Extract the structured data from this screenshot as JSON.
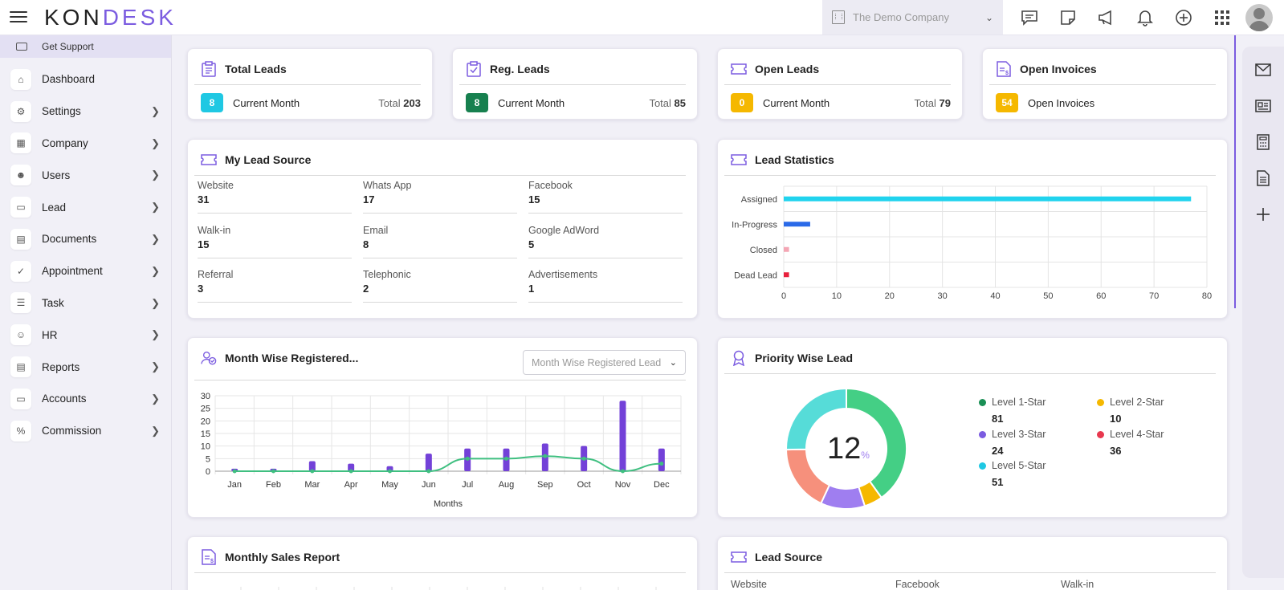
{
  "app": {
    "logo_left": "KON",
    "logo_right": "DESK",
    "company": "The Demo Company"
  },
  "top_icons": [
    "chat-icon",
    "sticky-note-icon",
    "megaphone-icon",
    "bell-icon",
    "plus-circle-icon",
    "apps-grid-icon"
  ],
  "sidebar": {
    "support": "Get Support",
    "items": [
      {
        "label": "Dashboard",
        "icon": "home-icon",
        "arrow": false
      },
      {
        "label": "Settings",
        "icon": "gear-icon",
        "arrow": true
      },
      {
        "label": "Company",
        "icon": "building-icon",
        "arrow": true
      },
      {
        "label": "Users",
        "icon": "users-icon",
        "arrow": true
      },
      {
        "label": "Lead",
        "icon": "ticket-icon",
        "arrow": true
      },
      {
        "label": "Documents",
        "icon": "document-icon",
        "arrow": true
      },
      {
        "label": "Appointment",
        "icon": "calendar-check-icon",
        "arrow": true
      },
      {
        "label": "Task",
        "icon": "task-list-icon",
        "arrow": true
      },
      {
        "label": "HR",
        "icon": "hr-icon",
        "arrow": true
      },
      {
        "label": "Reports",
        "icon": "report-icon",
        "arrow": true
      },
      {
        "label": "Accounts",
        "icon": "accounts-icon",
        "arrow": true
      },
      {
        "label": "Commission",
        "icon": "percent-icon",
        "arrow": true
      }
    ]
  },
  "rail_icons": [
    "mail-icon",
    "id-card-icon",
    "calculator-icon",
    "file-text-icon",
    "plus-icon"
  ],
  "summary": [
    {
      "title": "Total Leads",
      "badge": "8",
      "badge_color": "#1fc8e3",
      "label": "Current Month",
      "total_label": "Total",
      "total": "203"
    },
    {
      "title": "Reg. Leads",
      "badge": "8",
      "badge_color": "#17804f",
      "label": "Current Month",
      "total_label": "Total",
      "total": "85"
    },
    {
      "title": "Open Leads",
      "badge": "0",
      "badge_color": "#f5b800",
      "label": "Current Month",
      "total_label": "Total",
      "total": "79"
    },
    {
      "title": "Open Invoices",
      "badge": "54",
      "badge_color": "#f5b800",
      "label": "Open Invoices",
      "total_label": "",
      "total": ""
    }
  ],
  "lead_source_card": {
    "title": "My Lead Source",
    "items": [
      {
        "label": "Website",
        "value": "31"
      },
      {
        "label": "Whats App",
        "value": "17"
      },
      {
        "label": "Facebook",
        "value": "15"
      },
      {
        "label": "Walk-in",
        "value": "15"
      },
      {
        "label": "Email",
        "value": "8"
      },
      {
        "label": "Google AdWord",
        "value": "5"
      },
      {
        "label": "Referral",
        "value": "3"
      },
      {
        "label": "Telephonic",
        "value": "2"
      },
      {
        "label": "Advertisements",
        "value": "1"
      }
    ]
  },
  "lead_stats_card": {
    "title": "Lead Statistics"
  },
  "month_card": {
    "title": "Month Wise Registered...",
    "select_value": "Month Wise Registered Lead",
    "xlabel": "Months"
  },
  "priority_card": {
    "title": "Priority Wise Lead",
    "center_value": "12",
    "center_unit": "%",
    "legend": [
      {
        "label": "Level 1-Star",
        "value": "81",
        "color": "#1a8f55"
      },
      {
        "label": "Level 2-Star",
        "value": "10",
        "color": "#f5b800"
      },
      {
        "label": "Level 3-Star",
        "value": "24",
        "color": "#7b5ce0"
      },
      {
        "label": "Level 4-Star",
        "value": "36",
        "color": "#e8384f"
      },
      {
        "label": "Level 5-Star",
        "value": "51",
        "color": "#1fc8e3"
      }
    ]
  },
  "sales_card": {
    "title": "Monthly Sales Report"
  },
  "source_card": {
    "title": "Lead Source",
    "labels": [
      "Website",
      "Facebook",
      "Walk-in"
    ]
  },
  "chart_data": [
    {
      "type": "bar",
      "orientation": "horizontal",
      "categories": [
        "Assigned",
        "In-Progress",
        "Closed",
        "Dead Lead"
      ],
      "values": [
        77,
        5,
        1,
        1
      ],
      "colors": [
        "#20d3ee",
        "#2a6ae8",
        "#f4a6b4",
        "#e8203c"
      ],
      "xlim": [
        0,
        80
      ],
      "xticks": [
        0,
        10,
        20,
        30,
        40,
        50,
        60,
        70,
        80
      ],
      "grid": true
    },
    {
      "type": "bar",
      "categories": [
        "Jan",
        "Feb",
        "Mar",
        "Apr",
        "May",
        "Jun",
        "Jul",
        "Aug",
        "Sep",
        "Oct",
        "Nov",
        "Dec"
      ],
      "series": [
        {
          "type": "bar",
          "values": [
            1,
            1,
            4,
            3,
            2,
            7,
            9,
            9,
            11,
            10,
            28,
            9
          ],
          "color": "#7341d8"
        },
        {
          "type": "line",
          "values": [
            0,
            0,
            0,
            0,
            0,
            0,
            5,
            5,
            6,
            5,
            0,
            3
          ],
          "color": "#3fbf80"
        }
      ],
      "xlabel": "Months",
      "ylim": [
        0,
        30
      ],
      "yticks": [
        0,
        5,
        10,
        15,
        20,
        25,
        30
      ],
      "grid": true
    },
    {
      "type": "pie",
      "donut": true,
      "categories": [
        "Level 1-Star",
        "Level 2-Star",
        "Level 3-Star",
        "Level 4-Star",
        "Level 5-Star"
      ],
      "values": [
        81,
        10,
        24,
        36,
        51
      ],
      "colors": [
        "#44cf85",
        "#f5b800",
        "#9f7ef0",
        "#f6907c",
        "#56dcd8"
      ],
      "center_label": "12%"
    }
  ]
}
